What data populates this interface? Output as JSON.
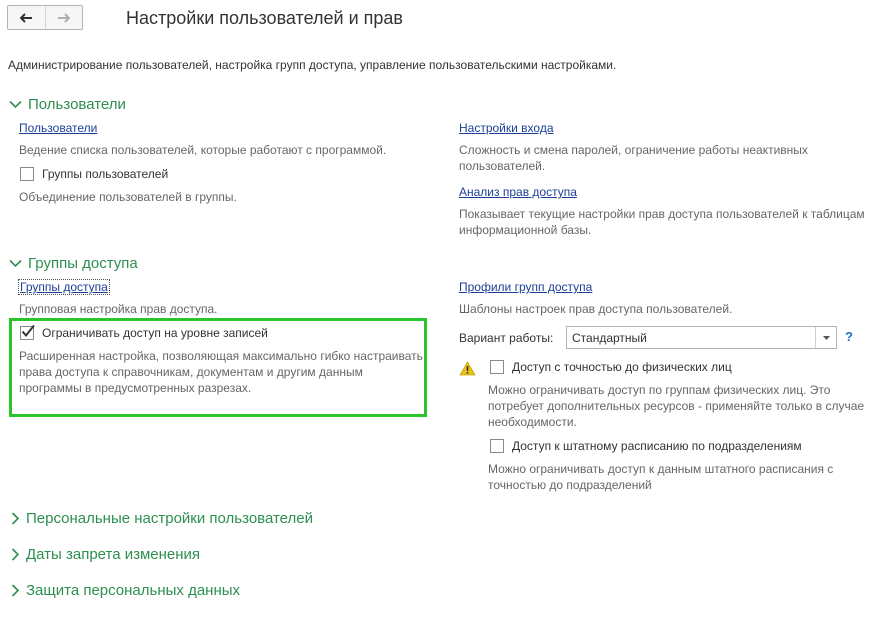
{
  "window": {
    "title": "Настройки пользователей и прав",
    "description": "Администрирование пользователей, настройка групп доступа, управление пользовательскими настройками."
  },
  "nav": {
    "back_icon": "arrow-left-icon",
    "forward_icon": "arrow-right-icon"
  },
  "sections": {
    "users": {
      "title": "Пользователи",
      "expanded": true,
      "users_link": "Пользователи",
      "users_desc": "Ведение списка пользователей, которые работают с программой.",
      "groups_checkbox_label": "Группы пользователей",
      "groups_checked": false,
      "groups_desc": "Объединение пользователей в группы.",
      "login_link": "Настройки входа",
      "login_desc": "Сложность и смена паролей, ограничение работы неактивных пользователей.",
      "analysis_link": "Анализ прав доступа",
      "analysis_desc": "Показывает текущие настройки прав доступа пользователей к таблицам информационной базы."
    },
    "access_groups": {
      "title": "Группы доступа",
      "expanded": true,
      "groups_link": "Группы доступа",
      "groups_desc": "Групповая настройка прав доступа.",
      "restrict_label": "Ограничивать доступ на уровне записей",
      "restrict_checked": true,
      "restrict_desc": "Расширенная настройка, позволяющая максимально гибко настраивать права доступа к справочникам, документам и другим данным программы в предусмотренных разрезах.",
      "profiles_link": "Профили групп доступа",
      "profiles_desc": "Шаблоны настроек прав доступа пользователей.",
      "mode_label": "Вариант работы:",
      "mode_value": "Стандартный",
      "help": "?",
      "persons_label": "Доступ с точностью до физических лиц",
      "persons_checked": false,
      "persons_desc": "Можно ограничивать доступ по группам физических лиц. Это потребует дополнительных ресурсов - применяйте только в случае необходимости.",
      "staff_label": "Доступ к штатному расписанию по подразделениям",
      "staff_checked": false,
      "staff_desc": "Можно ограничивать доступ к данным штатного расписания с точностью до подразделений",
      "warning_icon": "warning-icon"
    },
    "personal_settings": {
      "title": "Персональные настройки пользователей",
      "expanded": false
    },
    "change_prohibition": {
      "title": "Даты запрета изменения",
      "expanded": false
    },
    "personal_data": {
      "title": "Защита персональных данных",
      "expanded": false
    }
  },
  "colors": {
    "section_heading": "#2e8f50",
    "link": "#1c3f95",
    "highlight_frame": "#2bc52b",
    "warning": "#e8c21a"
  }
}
